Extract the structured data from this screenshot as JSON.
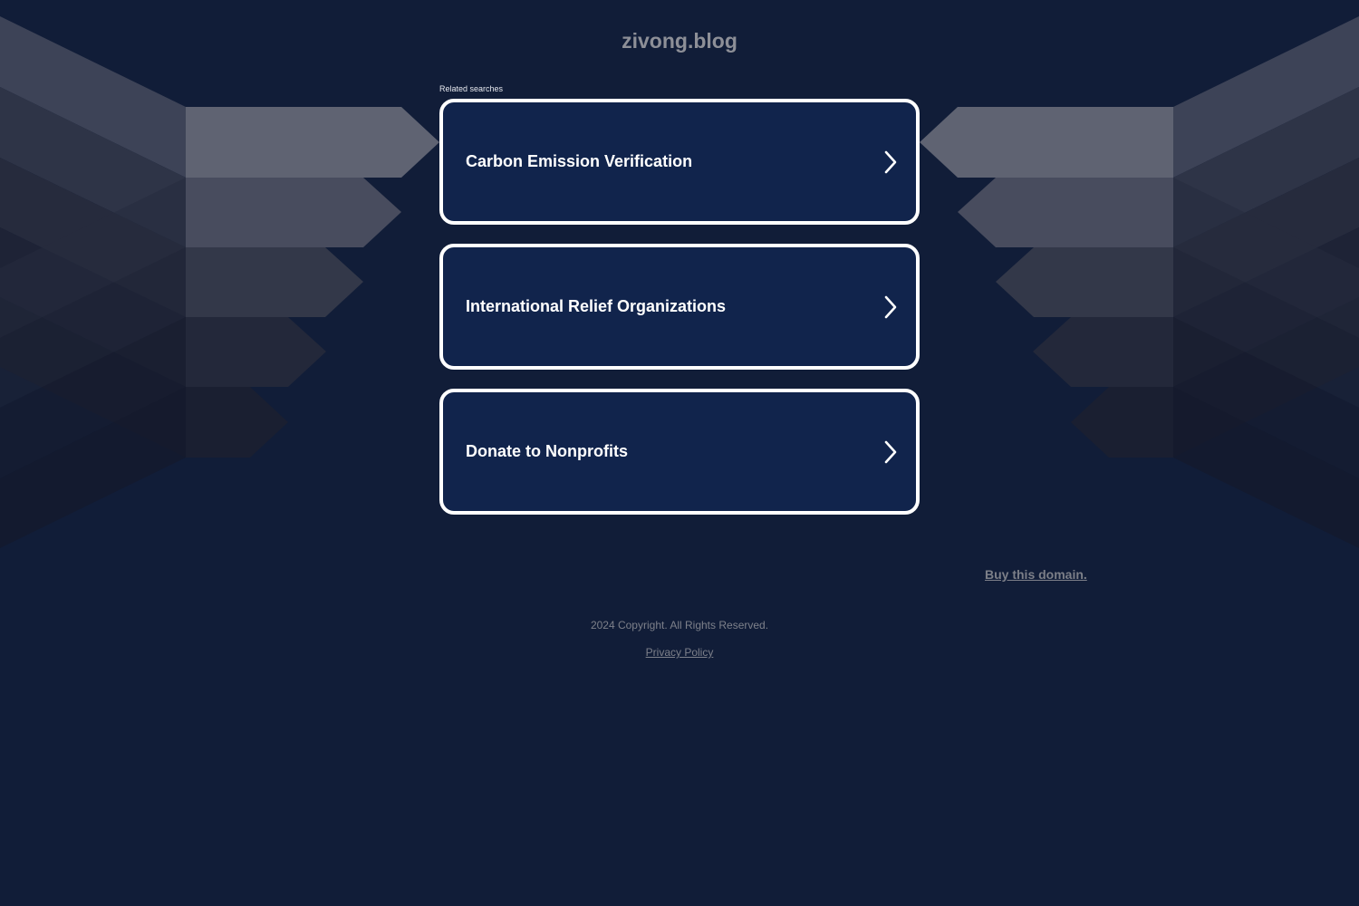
{
  "site": {
    "title": "zivong.blog"
  },
  "related": {
    "label": "Related searches",
    "items": [
      {
        "label": "Carbon Emission Verification"
      },
      {
        "label": "International Relief Organizations"
      },
      {
        "label": "Donate to Nonprofits"
      }
    ]
  },
  "footer": {
    "buy_label": "Buy this domain.",
    "copyright": "2024 Copyright. All Rights Reserved.",
    "privacy_label": "Privacy Policy"
  },
  "icons": {
    "card_chevron": "chevron-right-icon"
  },
  "colors": {
    "background": "#111d38",
    "card_background": "#11244c",
    "card_border": "#ffffff"
  }
}
